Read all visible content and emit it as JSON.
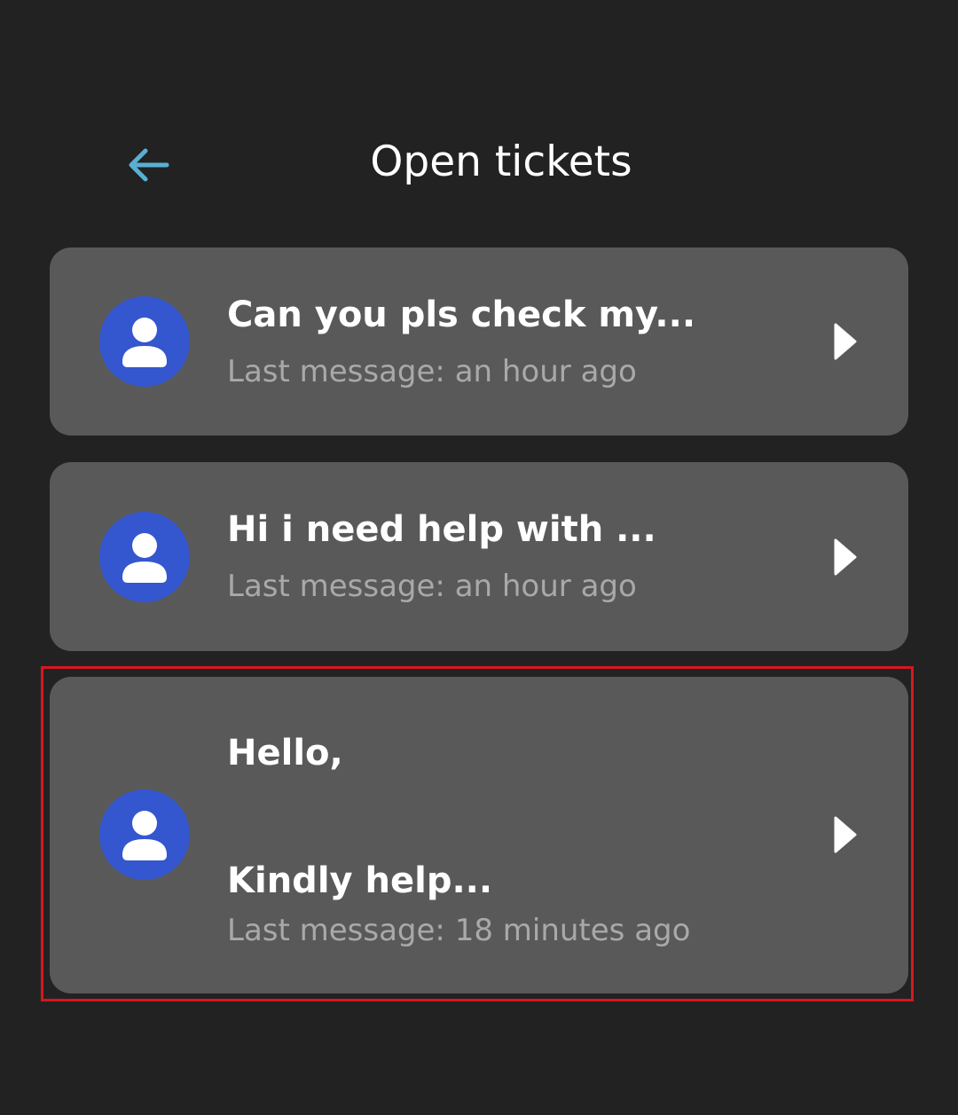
{
  "header": {
    "title": "Open tickets",
    "back_icon": "arrow-left-icon",
    "accent_color": "#5aaed4"
  },
  "tickets": [
    {
      "title": "Can you pls check my...",
      "meta": "Last message: an hour ago",
      "avatar_icon": "person-icon",
      "chevron_icon": "chevron-right-icon"
    },
    {
      "title": "Hi i need help with ...",
      "meta": "Last message: an hour ago",
      "avatar_icon": "person-icon",
      "chevron_icon": "chevron-right-icon"
    },
    {
      "title": "Hello,\n\nKindly help...",
      "meta": "Last message: 18 minutes ago",
      "avatar_icon": "person-icon",
      "chevron_icon": "chevron-right-icon",
      "highlighted": true
    }
  ],
  "colors": {
    "background": "#222222",
    "card": "#595959",
    "avatar": "#3456cf",
    "highlight": "#d7171f"
  }
}
